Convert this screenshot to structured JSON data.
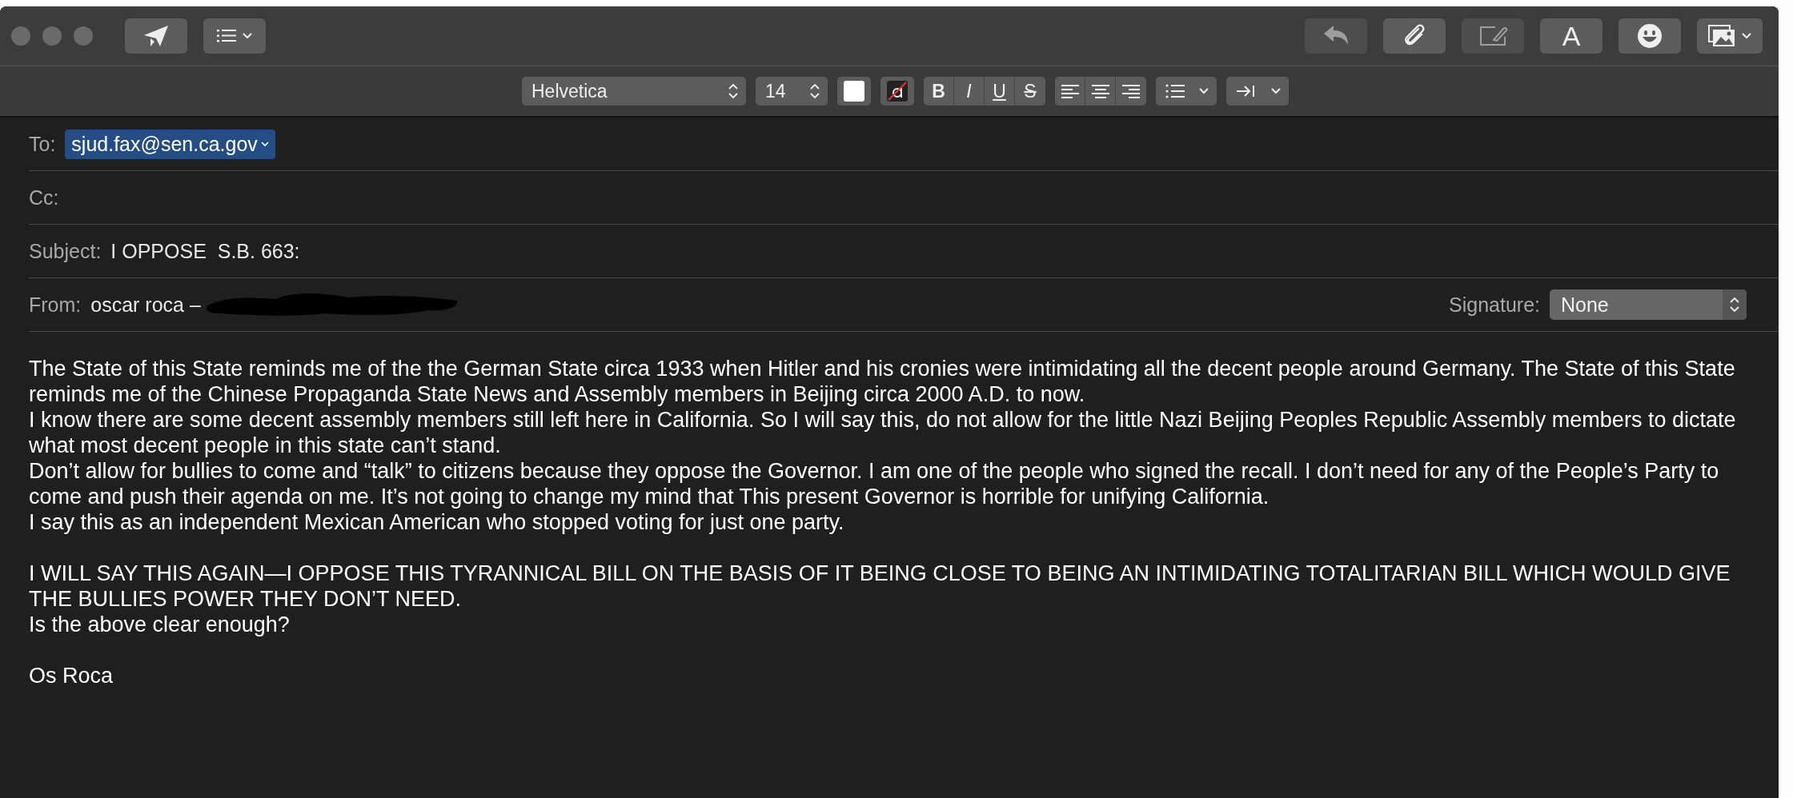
{
  "toolbar": {
    "left": [
      {
        "kind": "send",
        "disabled": false
      },
      {
        "kind": "header-menu",
        "disabled": false
      }
    ],
    "right": [
      {
        "kind": "reply",
        "disabled": true
      },
      {
        "kind": "attach",
        "disabled": false
      },
      {
        "kind": "markup",
        "disabled": true
      },
      {
        "kind": "fonts",
        "label": "A",
        "disabled": false
      },
      {
        "kind": "emoji",
        "disabled": false
      },
      {
        "kind": "photo",
        "disabled": false
      }
    ]
  },
  "format_bar": {
    "font": "Helvetica",
    "size": "14",
    "styles": [
      {
        "label": "B",
        "kind": "bold"
      },
      {
        "label": "I",
        "kind": "italic"
      },
      {
        "label": "U",
        "kind": "underline"
      },
      {
        "label": "S",
        "kind": "strike"
      }
    ],
    "alignments": [
      {
        "kind": "left"
      },
      {
        "kind": "center"
      },
      {
        "kind": "right"
      }
    ]
  },
  "header": {
    "to_label": "To:",
    "to": [
      "sjud.fax@sen.ca.gov"
    ],
    "cc_label": "Cc:",
    "subject_label": "Subject:",
    "subject": "I OPPOSE  S.B. 663:",
    "from_label": "From:",
    "from": "oscar roca –",
    "from_redacted": true,
    "signature_label": "Signature:",
    "signature": "None"
  },
  "body_blocks": [
    [
      "The State of this State reminds me of the the German State circa 1933 when Hitler and his cronies were intimidating all the decent people around Germany. The State of this State reminds me of the Chinese Propaganda State News and Assembly members in Beijing circa 2000 A.D. to now.",
      "I know there are some decent assembly members still left here in California. So I will say this, do not allow for the little Nazi Beijing Peoples Republic Assembly members to dictate what most decent people in this state can’t stand.",
      "Don’t allow for bullies to come and “talk” to citizens because they oppose the Governor. I am one of the people who signed the recall. I don’t need for any of the People’s Party to come and push their agenda on me. It’s not going to change my mind that This present Governor is horrible for unifying California.",
      "I say this as an independent Mexican American who stopped voting for just one party."
    ],
    [
      "I WILL SAY THIS AGAIN—I OPPOSE THIS TYRANNICAL BILL ON THE BASIS OF IT BEING CLOSE TO BEING AN INTIMIDATING TOTALITARIAN BILL WHICH WOULD GIVE THE BULLIES POWER THEY DON’T NEED.",
      "Is the above clear enough?"
    ],
    [
      "Os Roca"
    ]
  ]
}
